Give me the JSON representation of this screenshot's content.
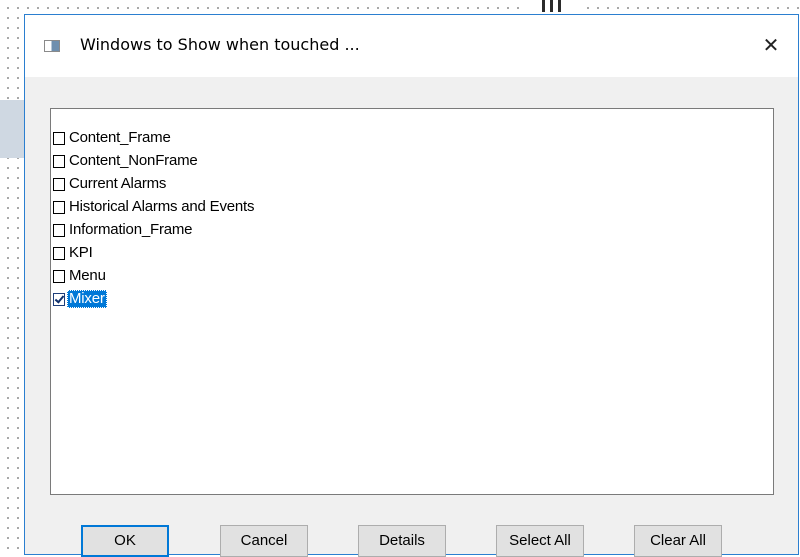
{
  "dialog": {
    "title": "Windows to Show when touched ...",
    "close_glyph": "✕",
    "icon": "window-icon"
  },
  "window_list": {
    "items": [
      {
        "label": "Content_Frame",
        "checked": false
      },
      {
        "label": "Content_NonFrame",
        "checked": false
      },
      {
        "label": "Current Alarms",
        "checked": false
      },
      {
        "label": "Historical Alarms and Events",
        "checked": false
      },
      {
        "label": "Information_Frame",
        "checked": false
      },
      {
        "label": "KPI",
        "checked": false
      },
      {
        "label": "Menu",
        "checked": false
      },
      {
        "label": "Mixer",
        "checked": true,
        "selected": true
      }
    ]
  },
  "buttons": {
    "ok": "OK",
    "cancel": "Cancel",
    "details": "Details",
    "select_all": "Select All",
    "clear_all": "Clear All"
  },
  "colors": {
    "accent": "#0078d7",
    "dialog_border": "#2b7fd0",
    "dialog_background": "#f0f0f0",
    "button_face": "#e1e1e1"
  }
}
